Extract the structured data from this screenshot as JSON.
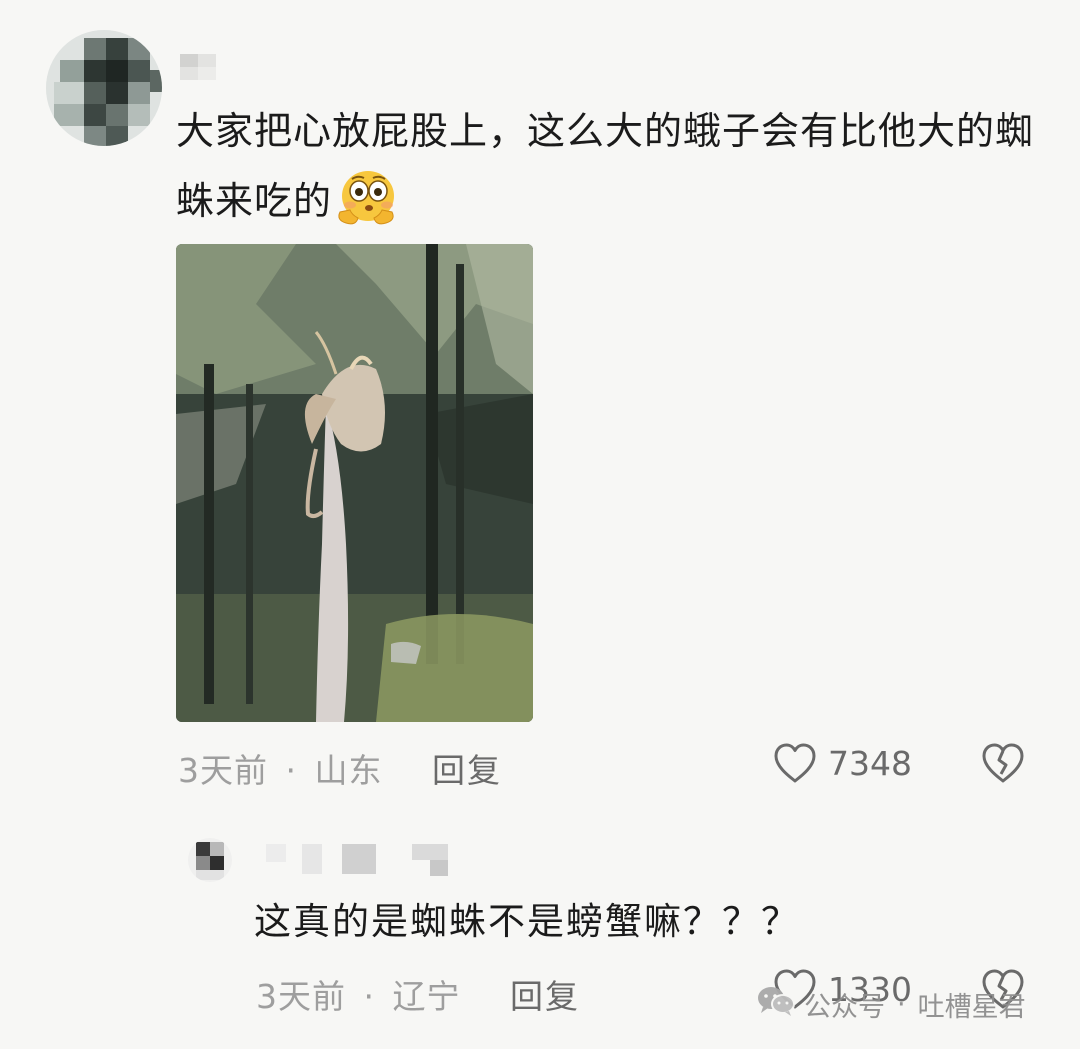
{
  "comment": {
    "text": "大家把心放屁股上，这么大的蛾子会有比他大的蜘蛛来吃的",
    "emoji": "flushed-emoji",
    "time": "3天前",
    "location": "山东",
    "reply_label": "回复",
    "like_count": "7348"
  },
  "reply": {
    "text": "这真的是蜘蛛不是螃蟹嘛？？？",
    "time": "3天前",
    "location": "辽宁",
    "reply_label": "回复",
    "like_count": "1330"
  },
  "separator": "·",
  "watermark": {
    "source": "公众号",
    "separator": "·",
    "account": "吐槽星君"
  },
  "colors": {
    "background": "#f7f7f5",
    "text_primary": "#1b1b1b",
    "text_meta": "#9e9e9e",
    "icon": "#6a6a6a"
  }
}
